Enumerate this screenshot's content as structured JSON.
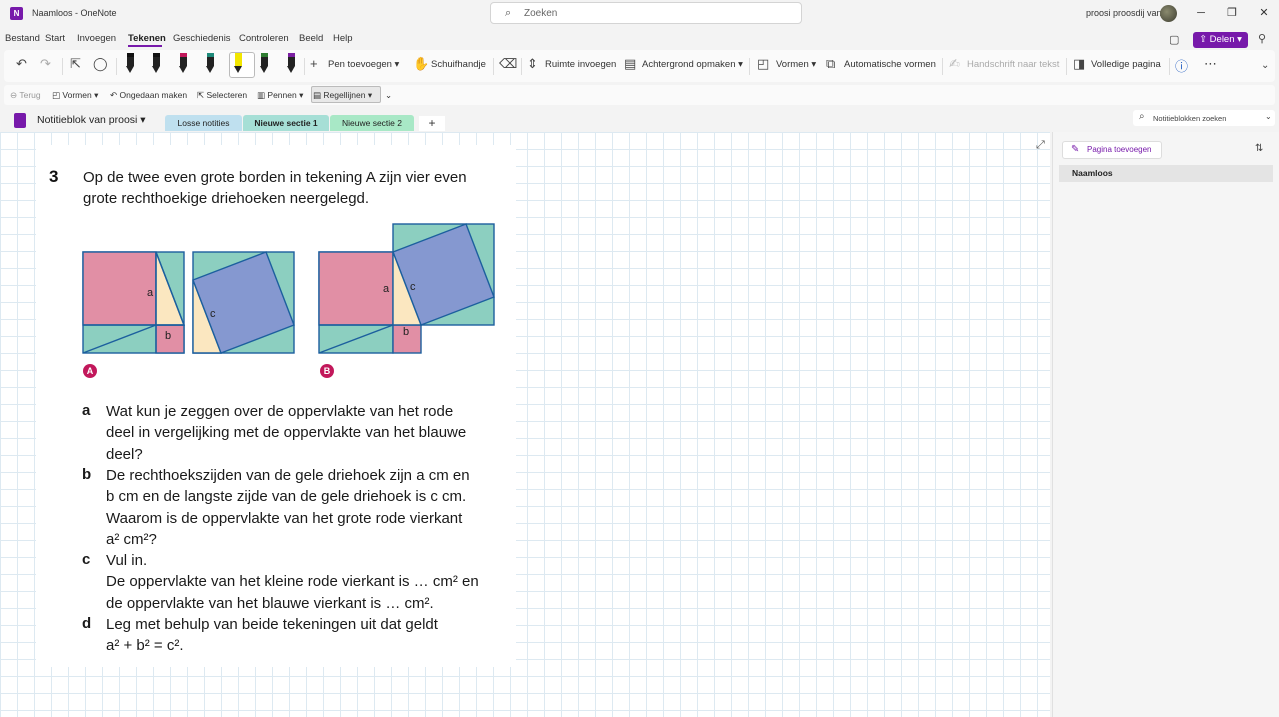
{
  "titlebar": {
    "logo": "N",
    "title": "Naamloos - OneNote",
    "search_placeholder": "Zoeken",
    "user": "proosi proosdij van"
  },
  "menu": {
    "items": [
      "Bestand",
      "Start",
      "Invoegen",
      "Tekenen",
      "Geschiedenis",
      "Controleren",
      "Beeld",
      "Help"
    ],
    "active": "Tekenen",
    "share": "Delen"
  },
  "ribbon": {
    "add_pen": "Pen toevoegen",
    "pan": "Schuifhandje",
    "insert_space": "Ruimte invoegen",
    "background": "Achtergrond opmaken",
    "shapes": "Vormen",
    "auto_shapes": "Automatische vormen",
    "ink_to_text": "Handschrift naar tekst",
    "full_page": "Volledige pagina",
    "pen_colors": [
      "#111111",
      "#111111",
      "#c2185b",
      "#1e8a7a",
      "#f2e600",
      "#2f7d32",
      "#7b1fa2"
    ]
  },
  "quick_access": {
    "back": "Terug",
    "shapes": "Vormen",
    "undo": "Ongedaan maken",
    "select": "Selecteren",
    "pens": "Pennen",
    "rule_lines": "Regellijnen"
  },
  "sections": {
    "notebook": "Notitieblok van proosi",
    "tabs": [
      {
        "label": "Losse notities",
        "color": "#bfe0ef",
        "active": false
      },
      {
        "label": "Nieuwe sectie 1",
        "color": "#a6dfd6",
        "active": true
      },
      {
        "label": "Nieuwe sectie 2",
        "color": "#a8e8c6",
        "active": false
      }
    ],
    "add_tab": "+",
    "search_notebooks": "Notitieblokken zoeken"
  },
  "exercise": {
    "number": "3",
    "intro_lines": [
      "Op de twee even grote borden in tekening A zijn vier even",
      "grote rechthoekige driehoeken neergelegd."
    ],
    "figure_labels": {
      "a": "a",
      "b": "b",
      "c": "c",
      "A": "A",
      "B": "B"
    },
    "questions": [
      {
        "letter": "a",
        "lines": [
          "Wat kun je zeggen over de oppervlakte van het rode",
          "deel in vergelijking met de oppervlakte van het blauwe",
          "deel?"
        ]
      },
      {
        "letter": "b",
        "lines": [
          "De rechthoekszijden van de gele driehoek zijn a cm en",
          "b cm en de langste zijde van de gele driehoek is c cm.",
          "Waarom is de oppervlakte van het grote rode vierkant",
          "a² cm²?"
        ]
      },
      {
        "letter": "c",
        "lines": [
          "Vul in.",
          "De oppervlakte van het kleine rode vierkant is … cm² en",
          "de oppervlakte van het blauwe vierkant is … cm²."
        ]
      },
      {
        "letter": "d",
        "lines": [
          "Leg met behulp van beide tekeningen uit dat geldt",
          "a² + b² = c²."
        ]
      }
    ]
  },
  "pages_pane": {
    "add_page": "Pagina toevoegen",
    "pages": [
      "Naamloos"
    ]
  },
  "colors": {
    "accent": "#7719aa",
    "teal": "#8ccfc0",
    "pink": "#e18fa5",
    "blue": "#8598d0",
    "yellow": "#fbe7c0",
    "stroke": "#1c5f9e"
  }
}
